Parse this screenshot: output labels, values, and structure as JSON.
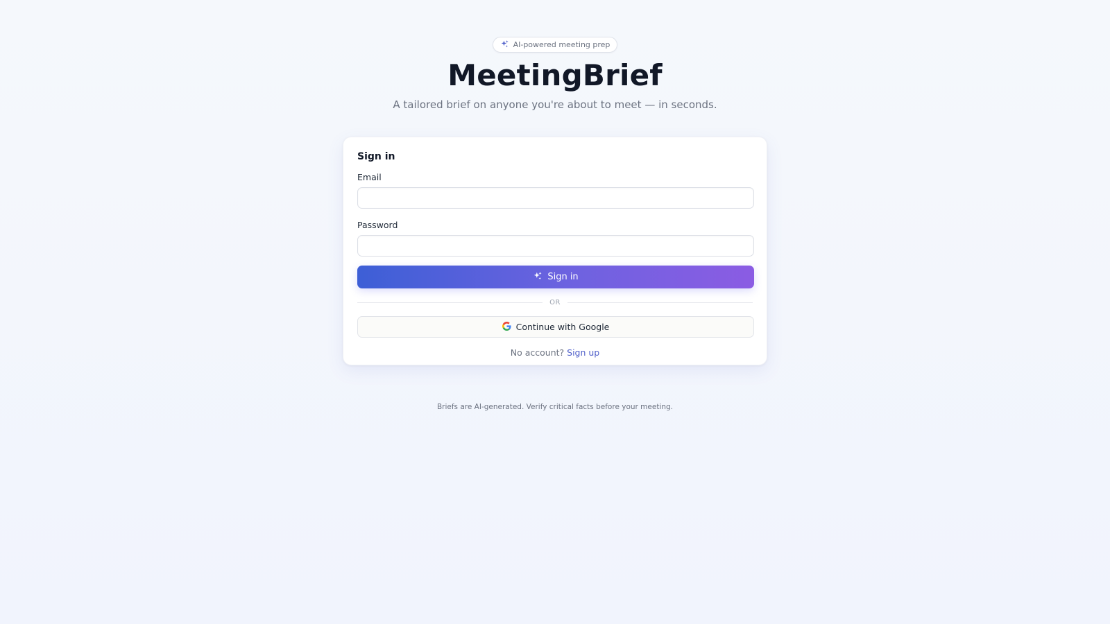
{
  "header": {
    "badge_icon": "sparkles-icon",
    "badge_label": "AI-powered meeting prep",
    "title": "MeetingBrief",
    "tagline": "A tailored brief on anyone you're about to meet — in seconds."
  },
  "signin_card": {
    "title": "Sign in",
    "email_label": "Email",
    "email_value": "",
    "password_label": "Password",
    "password_value": "",
    "submit_label": "Sign in",
    "submit_icon": "sparkles-icon",
    "divider_label": "OR",
    "google_label": "Continue with Google",
    "google_icon": "google-icon",
    "no_account_text": "No account?",
    "signup_link_label": "Sign up"
  },
  "footer": {
    "disclaimer": "Briefs are AI-generated. Verify critical facts before your meeting."
  },
  "colors": {
    "accent_start": "#3d5fd6",
    "accent_end": "#8b5ce3",
    "link": "#4f5fc9",
    "title": "#111827",
    "muted": "#6b7280"
  }
}
